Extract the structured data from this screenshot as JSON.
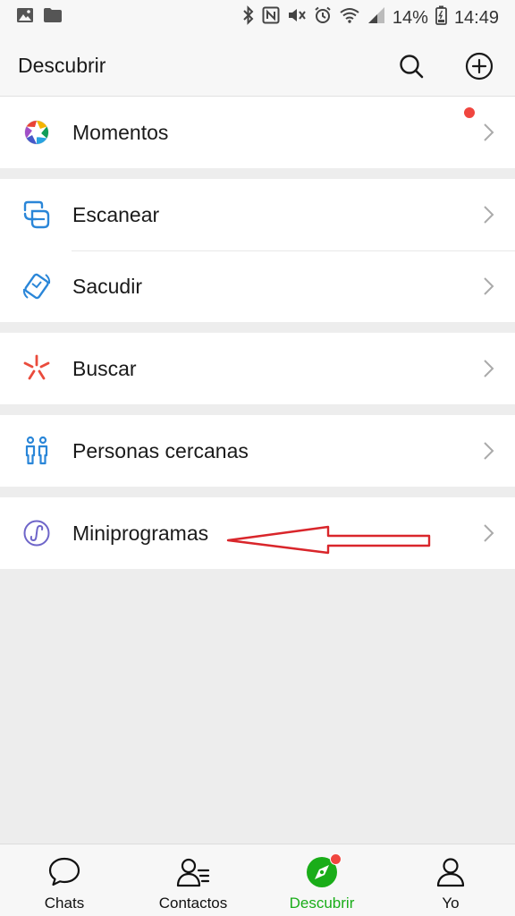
{
  "status_bar": {
    "battery_percent": "14%",
    "time": "14:49",
    "left_icons": [
      "image-icon",
      "folder-icon"
    ],
    "right_icons": [
      "bluetooth-icon",
      "nfc-icon",
      "mute-vibrate-icon",
      "alarm-icon",
      "wifi-icon",
      "signal-icon",
      "battery-icon"
    ]
  },
  "header": {
    "title": "Descubrir",
    "actions": [
      "search-icon",
      "add-circle-icon"
    ]
  },
  "menu": {
    "groups": [
      {
        "items": [
          {
            "label": "Momentos",
            "icon": "aperture-icon",
            "has_thumbnail": true,
            "has_badge": true
          }
        ]
      },
      {
        "items": [
          {
            "label": "Escanear",
            "icon": "scan-icon"
          },
          {
            "label": "Sacudir",
            "icon": "shake-icon"
          }
        ]
      },
      {
        "items": [
          {
            "label": "Buscar",
            "icon": "burst-icon"
          }
        ]
      },
      {
        "items": [
          {
            "label": "Personas cercanas",
            "icon": "people-nearby-icon"
          }
        ]
      },
      {
        "items": [
          {
            "label": "Miniprogramas",
            "icon": "mini-program-icon"
          }
        ]
      }
    ]
  },
  "tabs": [
    {
      "label": "Chats",
      "icon": "chat-bubble-icon",
      "active": false
    },
    {
      "label": "Contactos",
      "icon": "contacts-icon",
      "active": false
    },
    {
      "label": "Descubrir",
      "icon": "compass-icon",
      "active": true,
      "badge": true
    },
    {
      "label": "Yo",
      "icon": "person-icon",
      "active": false
    }
  ],
  "colors": {
    "accent_green": "#1aad19",
    "badge_red": "#f0463f",
    "annotation_arrow": "#d9262b",
    "background": "#ededed"
  }
}
